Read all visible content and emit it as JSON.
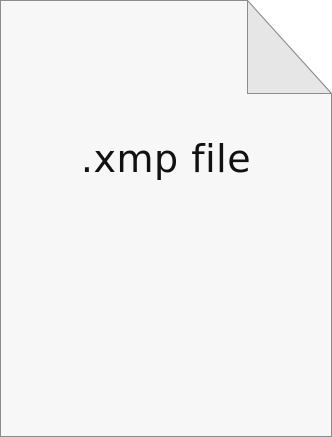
{
  "file_icon": {
    "label": ".xmp file",
    "icon": "document-icon",
    "colors": {
      "page": "#f7f7f7",
      "outline": "#8c8c8c",
      "fold": "#e6e6e6",
      "text": "#111111"
    }
  }
}
